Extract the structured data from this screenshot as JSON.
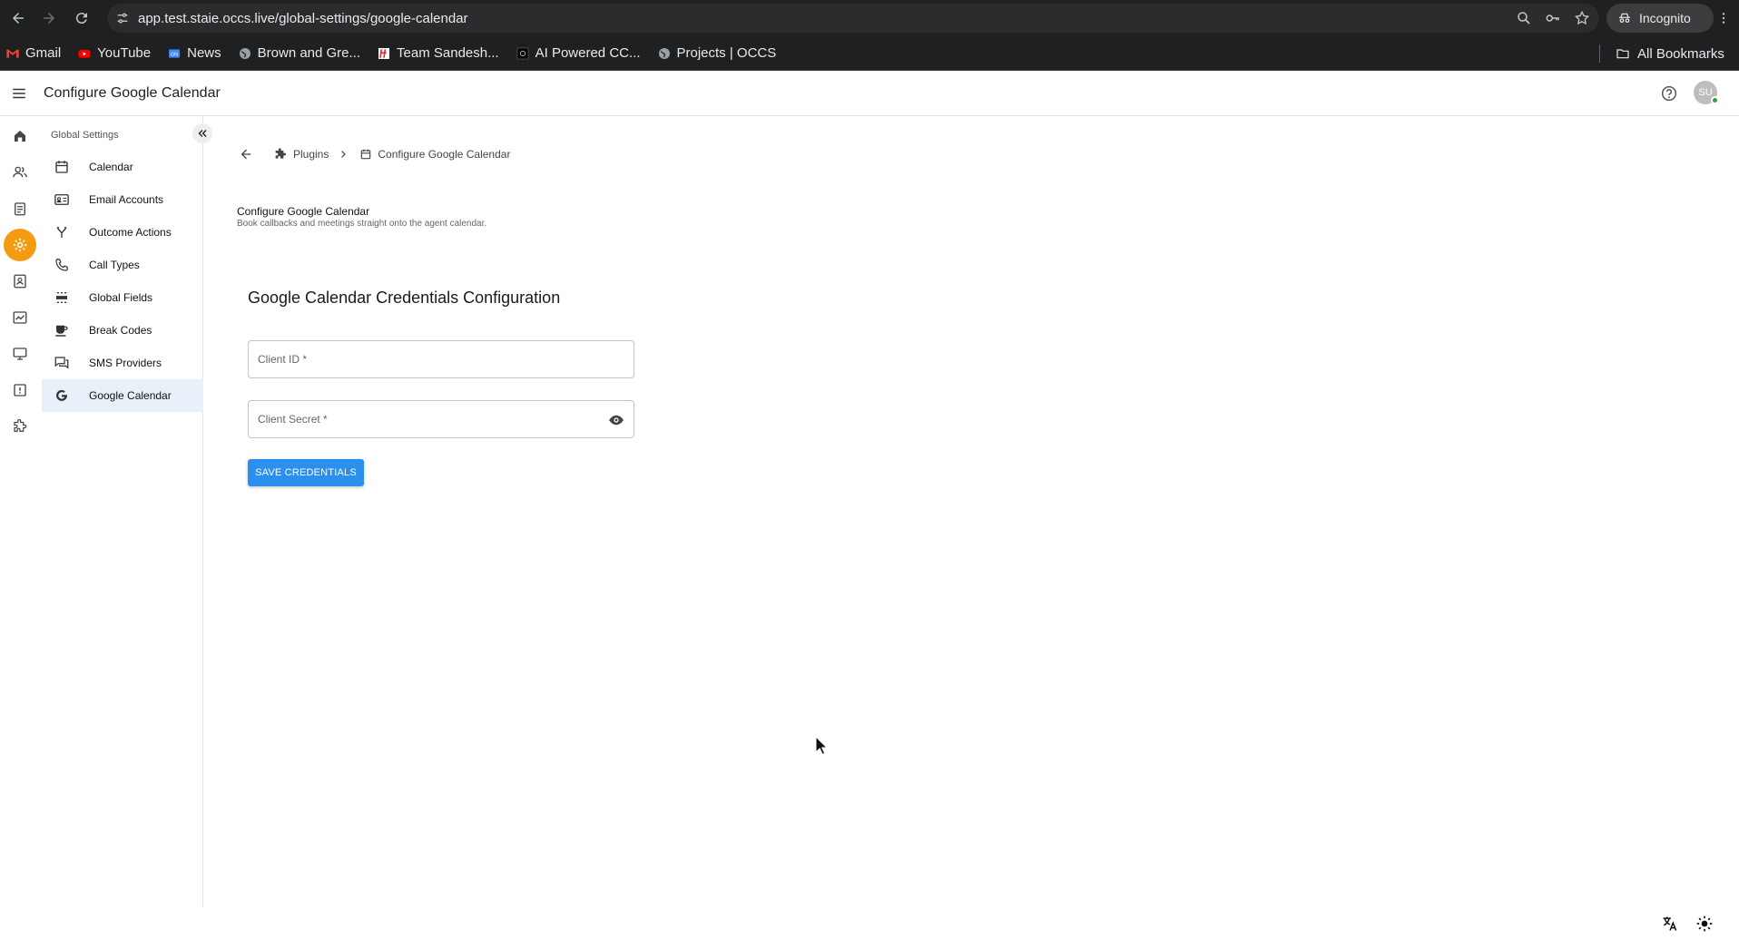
{
  "browser": {
    "url": "app.test.staie.occs.live/global-settings/google-calendar",
    "incognito_label": "Incognito",
    "bookmarks": [
      {
        "label": "Gmail",
        "icon": "gmail-icon"
      },
      {
        "label": "YouTube",
        "icon": "youtube-icon"
      },
      {
        "label": "News",
        "icon": "news-icon"
      },
      {
        "label": "Brown and Gre...",
        "icon": "globe-icon"
      },
      {
        "label": "Team Sandesh...",
        "icon": "sandesh-icon"
      },
      {
        "label": "AI Powered CC...",
        "icon": "ai-icon"
      },
      {
        "label": "Projects | OCCS",
        "icon": "globe-icon"
      }
    ],
    "all_bookmarks_label": "All Bookmarks"
  },
  "header": {
    "title": "Configure Google Calendar",
    "avatar_initials": "SU"
  },
  "sidebar": {
    "heading": "Global Settings",
    "items": [
      {
        "label": "Calendar",
        "icon": "calendar-icon"
      },
      {
        "label": "Email Accounts",
        "icon": "email-accounts-icon"
      },
      {
        "label": "Outcome Actions",
        "icon": "fork-icon"
      },
      {
        "label": "Call Types",
        "icon": "phone-icon"
      },
      {
        "label": "Global Fields",
        "icon": "fields-icon"
      },
      {
        "label": "Break Codes",
        "icon": "coffee-icon"
      },
      {
        "label": "SMS Providers",
        "icon": "sms-icon"
      },
      {
        "label": "Google Calendar",
        "icon": "google-icon"
      }
    ],
    "selected": "Google Calendar"
  },
  "breadcrumb": {
    "plugins": "Plugins",
    "current": "Configure Google Calendar"
  },
  "page": {
    "title": "Configure Google Calendar",
    "subtitle": "Book callbacks and meetings straight onto the agent calendar.",
    "section_title": "Google Calendar Credentials Configuration",
    "client_id_placeholder": "Client ID *",
    "client_secret_placeholder": "Client Secret *",
    "save_label": "SAVE CREDENTIALS"
  },
  "colors": {
    "accent": "#2b8ff0",
    "active_rail": "#f39c12",
    "selected_bg": "#e8f0fa"
  }
}
